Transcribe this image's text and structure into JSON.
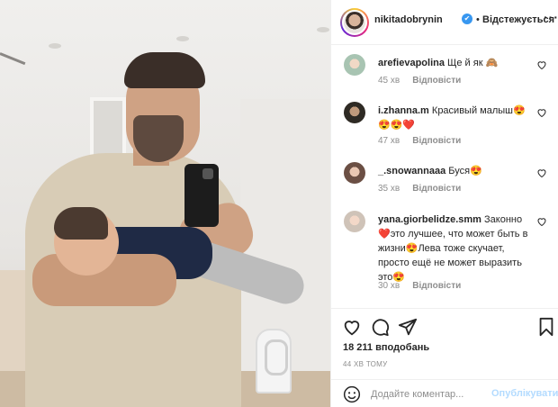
{
  "post": {
    "photo_alt": "man taking mirror selfie holding baby"
  },
  "header": {
    "username": "nikitadobrynin",
    "verified_mark": "✔",
    "separator": "•",
    "follow_status": "Відстежується",
    "more": "···"
  },
  "comments": [
    {
      "username": "arefievapolina",
      "text": "Ще й як 🙈",
      "time": "45 хв",
      "reply": "Відповісти"
    },
    {
      "username": "i.zhanna.m",
      "text": "Красивый малыш😍😍😍❤️",
      "time": "47 хв",
      "reply": "Відповісти"
    },
    {
      "username": "_.snowannaaa",
      "text": "Буся😍",
      "time": "35 хв",
      "reply": "Відповісти"
    },
    {
      "username": "yana.giorbelidze.smm",
      "text": "Законно ❤️это лучшее, что может быть в жизни😍Лева тоже скучает, просто ещё не может выразить это😍",
      "time": "30 хв",
      "reply": "Відповісти"
    }
  ],
  "actions": {
    "likes": "18 211 вподобань",
    "timestamp": "44 ХВ ТОМУ"
  },
  "add_comment": {
    "placeholder": "Додайте коментар...",
    "publish": "Опублікувати"
  },
  "colors": {
    "accent": "#3897f0",
    "publish_disabled": "#b3dbff",
    "heart": "#ed4956"
  }
}
